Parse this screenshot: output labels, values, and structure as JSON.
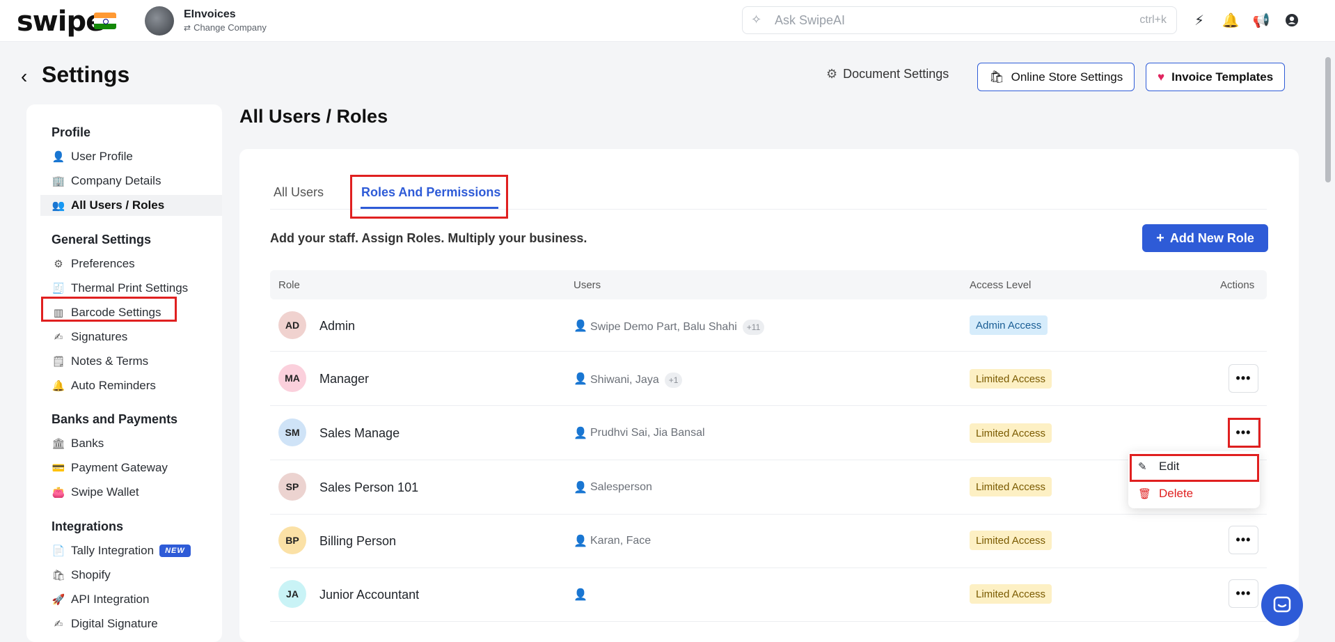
{
  "topbar": {
    "logo": "swipe",
    "company_name": "EInvoices",
    "change_company": "Change Company",
    "search_placeholder": "Ask SwipeAI",
    "search_shortcut": "ctrl+k"
  },
  "header": {
    "title": "Settings",
    "document_settings": "Document Settings",
    "online_store_settings": "Online Store Settings",
    "invoice_templates": "Invoice Templates"
  },
  "sidebar": {
    "sections": [
      {
        "title": "Profile",
        "items": [
          "User Profile",
          "Company Details",
          "All Users / Roles"
        ]
      },
      {
        "title": "General Settings",
        "items": [
          "Preferences",
          "Thermal Print Settings",
          "Barcode Settings",
          "Signatures",
          "Notes & Terms",
          "Auto Reminders"
        ]
      },
      {
        "title": "Banks and Payments",
        "items": [
          "Banks",
          "Payment Gateway",
          "Swipe Wallet"
        ]
      },
      {
        "title": "Integrations",
        "items": [
          "Tally Integration",
          "Shopify",
          "API Integration",
          "Digital Signature"
        ]
      }
    ],
    "new_badge": "NEW"
  },
  "main": {
    "title": "All Users / Roles",
    "tabs": [
      "All Users",
      "Roles And Permissions"
    ],
    "tagline": "Add your staff. Assign Roles. Multiply your business.",
    "add_button": "Add New Role",
    "columns": [
      "Role",
      "Users",
      "Access Level",
      "Actions"
    ],
    "rows": [
      {
        "initials": "AD",
        "name": "Admin",
        "users": "Swipe Demo Part, Balu Shahi",
        "more": "+11",
        "access": "Admin Access",
        "avatar_color": "#f0d2cf"
      },
      {
        "initials": "MA",
        "name": "Manager",
        "users": "Shiwani, Jaya",
        "more": "+1",
        "access": "Limited Access",
        "avatar_color": "#fbd0dc"
      },
      {
        "initials": "SM",
        "name": "Sales Manage",
        "users": "Prudhvi Sai, Jia Bansal",
        "more": "",
        "access": "Limited Access",
        "avatar_color": "#cfe3f7"
      },
      {
        "initials": "SP",
        "name": "Sales Person 101",
        "users": "Salesperson",
        "more": "",
        "access": "Limited Access",
        "avatar_color": "#ecd3d0"
      },
      {
        "initials": "BP",
        "name": "Billing Person",
        "users": "Karan, Face",
        "more": "",
        "access": "Limited Access",
        "avatar_color": "#fbe1a6"
      },
      {
        "initials": "JA",
        "name": "Junior Accountant",
        "users": "",
        "more": "",
        "access": "Limited Access",
        "avatar_color": "#c9f3f6"
      }
    ],
    "menu": {
      "edit": "Edit",
      "delete": "Delete"
    }
  },
  "colors": {
    "accent": "#2e5bd7",
    "highlight": "#e02020",
    "delete": "#e02020"
  }
}
